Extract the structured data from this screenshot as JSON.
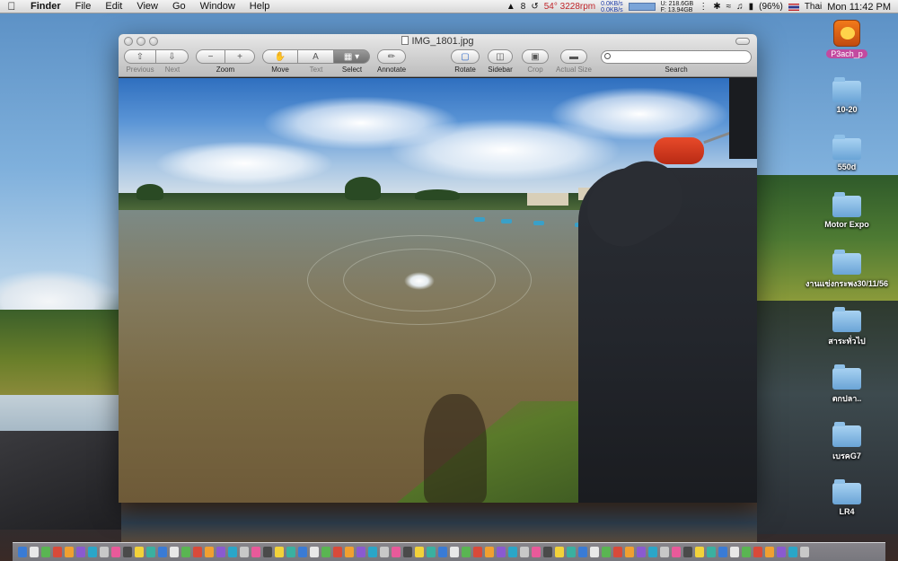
{
  "menubar": {
    "app_name": "Finder",
    "menus": [
      "File",
      "Edit",
      "View",
      "Go",
      "Window",
      "Help"
    ],
    "status": {
      "adobe_count": "8",
      "temperature": "54° 3228rpm",
      "net_up": "0.0KB/s",
      "net_down": "0.0KB/s",
      "disk_u": "U: 218.6GB",
      "disk_f": "F: 13.94GB",
      "battery": "(96%)",
      "input_language": "Thai",
      "clock": "Mon 11:42 PM"
    }
  },
  "window": {
    "title": "IMG_1801.jpg",
    "toolbar": {
      "previous": "Previous",
      "next": "Next",
      "zoom": "Zoom",
      "move": "Move",
      "text": "Text",
      "select": "Select",
      "annotate": "Annotate",
      "rotate": "Rotate",
      "sidebar": "Sidebar",
      "crop": "Crop",
      "actual_size": "Actual Size",
      "search": "Search"
    },
    "search_placeholder": ""
  },
  "desktop_icons": [
    {
      "label": "P3ach_p",
      "kind": "app"
    },
    {
      "label": "10-20",
      "kind": "folder"
    },
    {
      "label": "550d",
      "kind": "folder"
    },
    {
      "label": "Motor Expo",
      "kind": "folder"
    },
    {
      "label": "งานแข่งกระพง30/11/56",
      "kind": "folder"
    },
    {
      "label": "สาระทั่วไป",
      "kind": "folder"
    },
    {
      "label": "ตกปลา..",
      "kind": "folder"
    },
    {
      "label": "เบรคG7",
      "kind": "folder"
    },
    {
      "label": "LR4",
      "kind": "folder"
    }
  ],
  "colors": {
    "temperature_text": "#c0262b",
    "net_text": "#1b3aa8",
    "app_label_pill": "#c24aa0"
  }
}
